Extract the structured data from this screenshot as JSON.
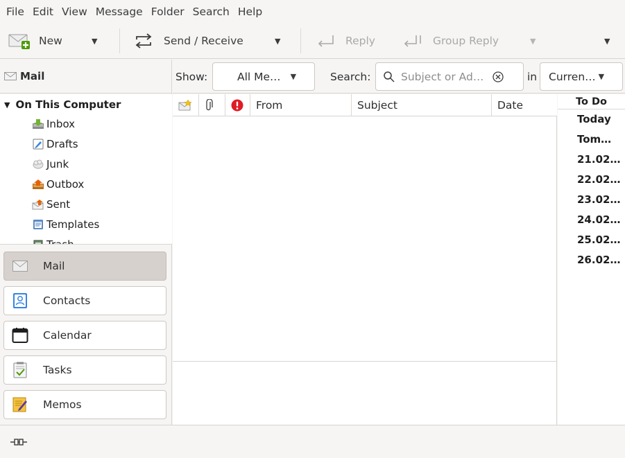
{
  "menu": [
    "File",
    "Edit",
    "View",
    "Message",
    "Folder",
    "Search",
    "Help"
  ],
  "toolbar": {
    "new_label": "New",
    "send_receive_label": "Send / Receive",
    "reply_label": "Reply",
    "group_reply_label": "Group Reply"
  },
  "sidebar": {
    "title": "Mail",
    "root": "On This Computer",
    "folders": [
      {
        "label": "Inbox",
        "icon": "inbox-icon"
      },
      {
        "label": "Drafts",
        "icon": "drafts-icon"
      },
      {
        "label": "Junk",
        "icon": "junk-icon"
      },
      {
        "label": "Outbox",
        "icon": "outbox-icon"
      },
      {
        "label": "Sent",
        "icon": "sent-icon"
      },
      {
        "label": "Templates",
        "icon": "templates-icon"
      },
      {
        "label": "Trash",
        "icon": "trash-icon"
      }
    ],
    "switcher": [
      {
        "label": "Mail",
        "icon": "mail-icon",
        "active": true
      },
      {
        "label": "Contacts",
        "icon": "contacts-icon"
      },
      {
        "label": "Calendar",
        "icon": "calendar-icon"
      },
      {
        "label": "Tasks",
        "icon": "tasks-icon"
      },
      {
        "label": "Memos",
        "icon": "memos-icon"
      }
    ]
  },
  "filter": {
    "show_label": "Show:",
    "show_value": "All Me…",
    "search_label": "Search:",
    "search_placeholder": "Subject or Ad…",
    "in_label": "in",
    "scope_value": "Curren…"
  },
  "list": {
    "columns": [
      "From",
      "Subject",
      "Date"
    ]
  },
  "todo": {
    "title": "To Do",
    "items": [
      "Today",
      "Tom…",
      "21.02…",
      "22.02…",
      "23.02…",
      "24.02…",
      "25.02…",
      "26.02…"
    ]
  },
  "colors": {
    "window_bg": "#f6f5f4",
    "pane_bg": "#ffffff",
    "active_switch_bg": "#d6d1cd",
    "important_red": "#e01b24",
    "contacts_blue": "#3584e4"
  }
}
